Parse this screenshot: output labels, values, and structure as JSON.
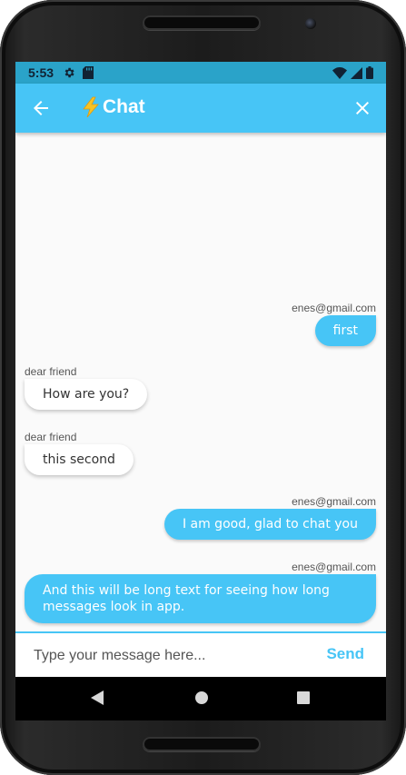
{
  "status_bar": {
    "time": "5:53",
    "left_icons": [
      "gear-icon",
      "sd-card-icon"
    ],
    "right_icons": [
      "wifi-icon",
      "signal-icon",
      "battery-icon"
    ],
    "color": "#2aa3c9"
  },
  "app_bar": {
    "title": "Chat",
    "title_emoji": "lightning-bolt-icon",
    "back_icon": "arrow-back-icon",
    "close_icon": "close-icon",
    "color": "#47c5f6"
  },
  "messages": [
    {
      "sender": "enes@gmail.com",
      "text": "first",
      "outgoing": true
    },
    {
      "sender": "dear friend",
      "text": "How are you?",
      "outgoing": false
    },
    {
      "sender": "dear friend",
      "text": "this second",
      "outgoing": false
    },
    {
      "sender": "enes@gmail.com",
      "text": "I am good, glad to chat you",
      "outgoing": true
    },
    {
      "sender": "enes@gmail.com",
      "text": "And this will be long text for seeing how long messages look in app.",
      "outgoing": true
    }
  ],
  "composer": {
    "placeholder": "Type your message here...",
    "value": "",
    "send_label": "Send"
  },
  "nav_bar": {
    "buttons": [
      "back-triangle-icon",
      "home-circle-icon",
      "recents-square-icon"
    ]
  }
}
